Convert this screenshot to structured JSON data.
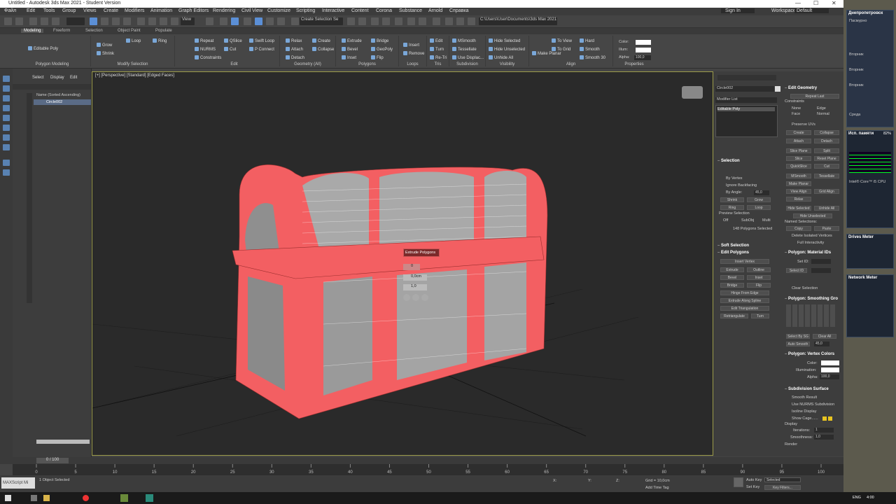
{
  "window": {
    "title": "Untitled - Autodesk 3ds Max 2021 - Student Version"
  },
  "menu": [
    "Файл",
    "Edit",
    "Tools",
    "Group",
    "Views",
    "Create",
    "Modifiers",
    "Animation",
    "Graph Editors",
    "Rendering",
    "Civil View",
    "Customize",
    "Scripting",
    "Interactive",
    "Content",
    "Corona",
    "Substance",
    "Arnold",
    "Справка"
  ],
  "signin": "Sign In",
  "workspaces_label": "Workspaces:",
  "workspace_value": "Default",
  "toolbar": {
    "view_dropdown": "View",
    "selection_set": "Create Selection Se",
    "path": "C:\\Users\\User\\Documents\\3ds Max 2021"
  },
  "ribbon_tabs": [
    "Modeling",
    "Freeform",
    "Selection",
    "Object Paint",
    "Populate"
  ],
  "ribbon": {
    "polygon_modeling": "Polygon Modeling",
    "editable_poly": "Editable Poly",
    "modify_selection": "Modify Selection",
    "mod_items": [
      "Grow",
      "Shrink",
      "Loop",
      "Ring"
    ],
    "edit": "Edit",
    "edit_items": [
      "Repeat",
      "QSlice",
      "Swift Loop",
      "NURMS",
      "Cut",
      "P Connect",
      "Constraints"
    ],
    "geometry": "Geometry (All)",
    "geom_items": [
      "Relax",
      "Create",
      "Attach",
      "Collapse",
      "Detach"
    ],
    "polygons": "Polygons",
    "poly_items": [
      "Extrude",
      "Bridge",
      "Bevel",
      "GeoPoly",
      "Inset",
      "Flip"
    ],
    "loops": "Loops",
    "loop_items": [
      "Insert",
      "Remove"
    ],
    "tris": "Tris",
    "tris_items": [
      "Edit",
      "Turn",
      "Re-Tri"
    ],
    "subdivision": "Subdivision",
    "subd_items": [
      "MSmooth",
      "Tessellate",
      "Use Displac..."
    ],
    "visibility": "Visibility",
    "vis_items": [
      "Hide Selected",
      "Hide Unselected",
      "Unhide All"
    ],
    "align": "Align",
    "align_items": [
      "Make Planar",
      "To View",
      "To Grid",
      "Hard",
      "Smooth",
      "Smooth 30"
    ],
    "properties": "Properties",
    "prop_items": [
      "Color:",
      "Illum:",
      "Alpha:"
    ],
    "alpha": "100,0"
  },
  "scene": {
    "tabs": [
      "Select",
      "Display",
      "Edit"
    ],
    "header": "Name (Sorted Ascending)",
    "object": "Circle002"
  },
  "viewport": {
    "label": "[+] [Perspective] [Standard] [Edged Faces]",
    "caddy_title": "Extrude Polygons",
    "caddy_v1": "0",
    "caddy_v2": "0,0cm",
    "caddy_v3": "1,0"
  },
  "cmd": {
    "object_name": "Circle002",
    "modifier_list": "Modifier List",
    "stack_item": "Editable Poly",
    "selection": "Selection",
    "by_vertex": "By Vertex",
    "ignore_backfacing": "Ignore Backfacing",
    "by_angle": "By Angle:",
    "angle": "45,0",
    "shrink": "Shrink",
    "grow": "Grow",
    "ring": "Ring",
    "loop": "Loop",
    "preview_selection": "Preview Selection",
    "off": "Off",
    "subobj": "SubObj",
    "multi": "Multi",
    "poly_selected": "148 Polygons Selected",
    "soft_selection": "Soft Selection",
    "edit_polygons": "Edit Polygons",
    "insert_vertex": "Insert Vertex",
    "ep": [
      "Extrude",
      "Outline",
      "Bevel",
      "Inset",
      "Bridge",
      "Flip"
    ],
    "hinge": "Hinge From Edge",
    "extrude_spline": "Extrude Along Spline",
    "edit_tri": "Edit Triangulation",
    "retriangulate": "Retriangulate",
    "turn": "Turn"
  },
  "cmd2": {
    "edit_geometry": "Edit Geometry",
    "repeat_last": "Repeat Last",
    "constraints": "Constraints",
    "c_opts": [
      "None",
      "Edge",
      "Face",
      "Normal"
    ],
    "preserve_uvs": "Preserve UVs",
    "create": "Create",
    "collapse": "Collapse",
    "attach": "Attach",
    "detach": "Detach",
    "slice_plane": "Slice Plane",
    "split": "Split",
    "slice": "Slice",
    "reset_plane": "Reset Plane",
    "quickslice": "QuickSlice",
    "cut": "Cut",
    "msmooth": "MSmooth",
    "tessellate": "Tessellate",
    "make_planar": "Make Planar",
    "view_align": "View Align",
    "grid_align": "Grid Align",
    "relax": "Relax",
    "hide_selected": "Hide Selected",
    "unhide_all": "Unhide All",
    "hide_unselected": "Hide Unselected",
    "named_selections": "Named Selections:",
    "copy": "Copy",
    "paste": "Paste",
    "delete_isolated": "Delete Isolated Vertices",
    "full_interactivity": "Full Interactivity",
    "material_ids": "Polygon: Material IDs",
    "set_id": "Set ID:",
    "select_id": "Select ID",
    "clear_selection": "Clear Selection",
    "smoothing": "Polygon: Smoothing Gro",
    "select_by_sg": "Select By SG",
    "clear_all": "Clear All",
    "auto_smooth": "Auto Smooth",
    "auto_smooth_val": "45,0",
    "vertex_colors": "Polygon: Vertex Colors",
    "color": "Color:",
    "illumination": "Illumination:",
    "alpha": "Alpha:",
    "alpha_val": "100,0",
    "subdiv_surface": "Subdivision Surface",
    "smooth_result": "Smooth Result",
    "use_nurms": "Use NURMS Subdivision",
    "isoline": "Isoline Display",
    "show_cage": "Show Cage......",
    "display": "Display",
    "iterations": "Iterations:",
    "iter_val": "1",
    "smoothness": "Smoothness:",
    "smooth_val": "1,0",
    "render": "Render"
  },
  "timeline": {
    "frame": "0 / 100",
    "ticks": [
      "0",
      "5",
      "10",
      "15",
      "20",
      "25",
      "30",
      "35",
      "40",
      "45",
      "50",
      "55",
      "60",
      "65",
      "70",
      "75",
      "80",
      "85",
      "90",
      "95",
      "100"
    ]
  },
  "status": {
    "maxscript": "MAXScript Mi",
    "selected": "1 Object Selected",
    "grid": "Grid = 10,0cm",
    "add_time_tag": "Add Time Tag",
    "auto_key": "Auto Key",
    "selected_dd": "Selected",
    "set_key": "Set Key",
    "key_filters": "Key Filters...",
    "x": "X:",
    "y": "Y:",
    "z": "Z:"
  },
  "taskbar": {
    "lang": "ENG",
    "time": "4:00"
  },
  "desktop": {
    "city": "Днепропетровск",
    "weather": "Пасмурно",
    "w_items": [
      "Вторник",
      "Вторник",
      "Вторник",
      "Среда"
    ],
    "mem": "Исп. памяти",
    "mem_pct": "82%",
    "cpu": "Intel® Core™ i5 CPU",
    "drives": "Drives Meter",
    "network": "Network Meter"
  }
}
